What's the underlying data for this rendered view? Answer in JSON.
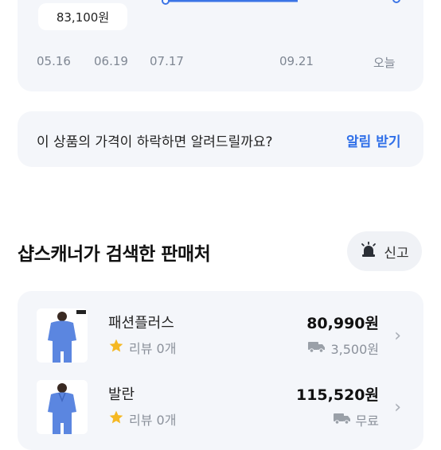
{
  "price_chart": {
    "current_price_label": "83,100원",
    "dates": [
      "05.16",
      "06.19",
      "07.17",
      "09.21",
      "오늘"
    ]
  },
  "price_alert": {
    "question": "이 상품의 가격이 하락하면 알려드릴까요?",
    "button_label": "알림 받기"
  },
  "sellers_section": {
    "title": "샵스캐너가 검색한 판매처",
    "report_label": "신고",
    "sellers": [
      {
        "name": "패션플러스",
        "review": "리뷰 0개",
        "price": "80,990원",
        "shipping": "3,500원"
      },
      {
        "name": "발란",
        "review": "리뷰 0개",
        "price": "115,520원",
        "shipping": "무료"
      }
    ]
  },
  "colors": {
    "accent": "#2f6fe8",
    "card_bg": "#f4f6fa",
    "product_blue": "#5b86e0",
    "star": "#f5b823"
  }
}
